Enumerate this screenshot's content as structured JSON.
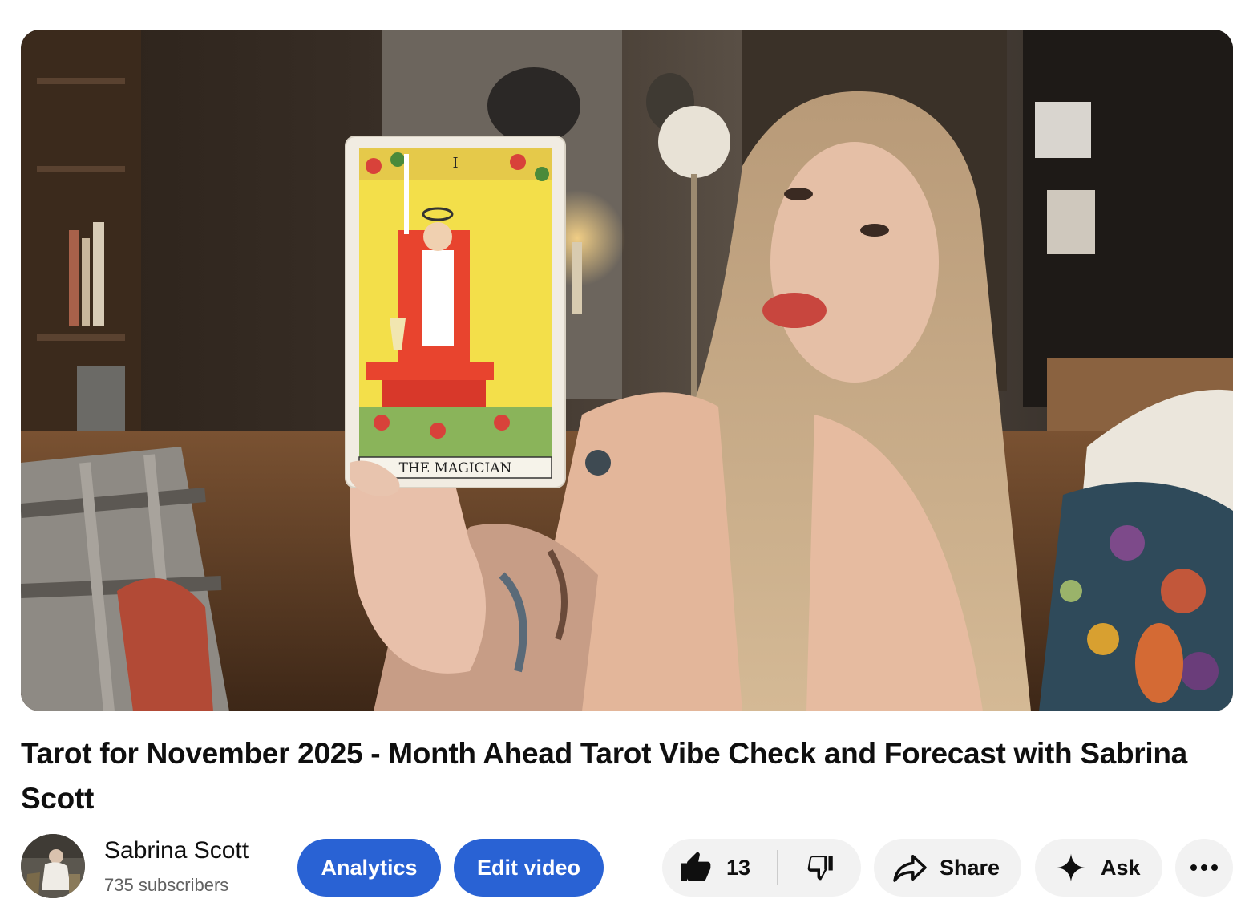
{
  "video": {
    "card_text": "THE MAGICIAN",
    "card_numeral": "I"
  },
  "title": "Tarot for November 2025 - Month Ahead Tarot Vibe Check and Forecast with Sabrina Scott",
  "channel": {
    "name": "Sabrina Scott",
    "subscribers": "735 subscribers"
  },
  "actions": {
    "analytics_label": "Analytics",
    "edit_label": "Edit video",
    "like_count": "13",
    "share_label": "Share",
    "ask_label": "Ask"
  },
  "icons": {
    "like": "thumbs-up-icon",
    "dislike": "thumbs-down-icon",
    "share": "share-arrow-icon",
    "ask": "sparkle-icon",
    "more": "more-horizontal-icon"
  },
  "colors": {
    "primary_button": "#2962d4",
    "pill_background": "#f2f2f2",
    "text_primary": "#0f0f0f",
    "text_secondary": "#606060"
  }
}
